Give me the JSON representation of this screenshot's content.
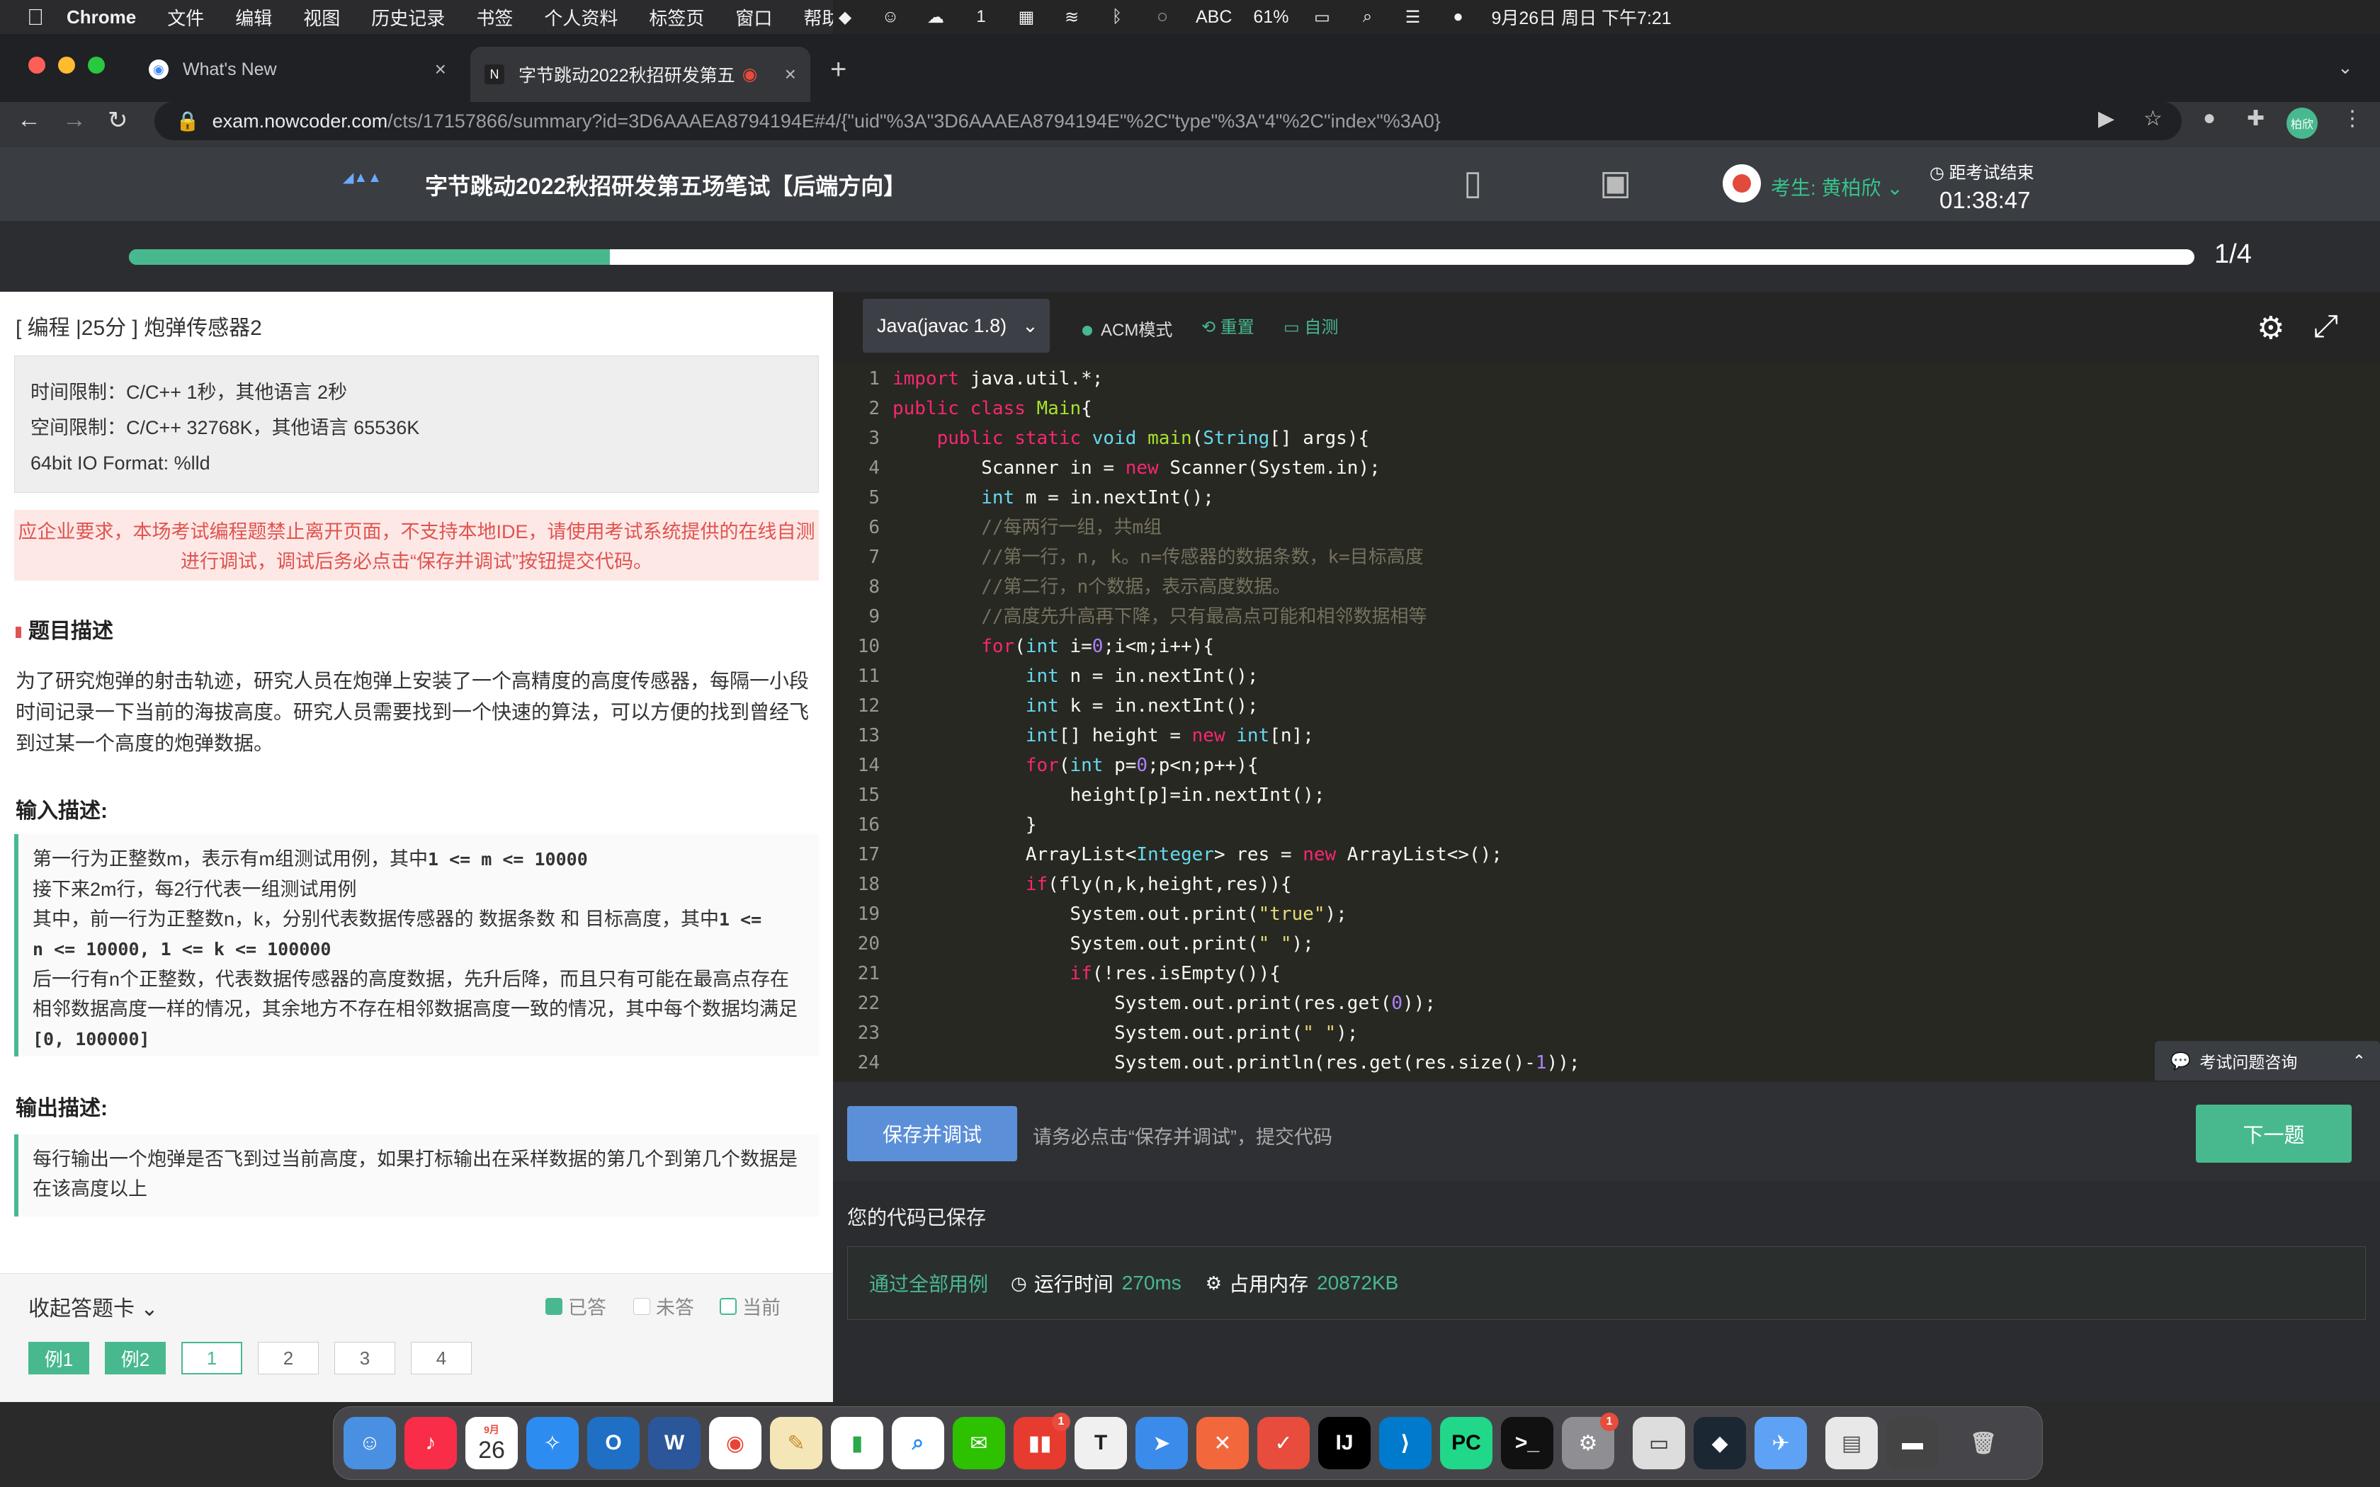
{
  "menubar": {
    "app": "Chrome",
    "items": [
      "文件",
      "编辑",
      "视图",
      "历史记录",
      "书签",
      "个人资料",
      "标签页",
      "窗口",
      "帮助"
    ],
    "status": {
      "input": "ABC",
      "battery": "61%",
      "datetime": "9月26日 周日 下午7:21",
      "wechat_count": "1"
    }
  },
  "browser": {
    "tabs": [
      {
        "title": "What's New",
        "active": false
      },
      {
        "title": "字节跳动2022秋招研发第五",
        "active": true
      }
    ],
    "url_host": "exam.nowcoder.com",
    "url_path": "/cts/17157866/summary?id=3D6AAAEA8794194E#4/{\"uid\"%3A\"3D6AAAEA8794194E\"%2C\"type\"%3A\"4\"%2C\"index\"%3A0}",
    "profile": "柏欣"
  },
  "exam": {
    "title": "字节跳动2022秋招研发第五场笔试【后端方向】",
    "candidate": "考生: 黄柏欣",
    "countdown_label": "距考试结束",
    "countdown": "01:38:47",
    "progress_fraction": 0.233,
    "progress_text": "1/4"
  },
  "question": {
    "title": "[ 编程 |25分 ] 炮弹传感器2",
    "limits": [
      "时间限制：C/C++ 1秒，其他语言 2秒",
      "空间限制：C/C++ 32768K，其他语言 65536K",
      "64bit IO Format: %lld"
    ],
    "notice": "应企业要求，本场考试编程题禁止离开页面，不支持本地IDE，请使用考试系统提供的在线自测进行调试，调试后务必点击“保存并调试”按钮提交代码。",
    "desc_heading": "题目描述",
    "desc": "为了研究炮弹的射击轨迹，研究人员在炮弹上安装了一个高精度的高度传感器，每隔一小段时间记录一下当前的海拔高度。研究人员需要找到一个快速的算法，可以方便的找到曾经飞到过某一个高度的炮弹数据。",
    "input_heading": "输入描述:",
    "input_lines": [
      "第一行为正整数m，表示有m组测试用例，其中",
      "1 <= m <= 10000",
      "接下来2m行，每2行代表一组测试用例",
      "其中，前一行为正整数n，k，分别代表数据传感器的 数据条数 和 目标高度，其中",
      "1 <=",
      "n <= 10000, 1 <= k <= 100000",
      "后一行有n个正整数，代表数据传感器的高度数据，先升后降，而且只有可能在最高点存在相邻数据高度一样的情况，其余地方不存在相邻数据高度一致的情况，其中每个数据均满足",
      "[0, 100000]"
    ],
    "output_heading": "输出描述:",
    "output": "每行输出一个炮弹是否飞到过当前高度，如果打标输出在采样数据的第几个到第几个数据是在该高度以上"
  },
  "answer_card": {
    "toggle": "收起答题卡",
    "legend": [
      "已答",
      "未答",
      "当前"
    ],
    "buttons": [
      "例1",
      "例2",
      "1",
      "2",
      "3",
      "4"
    ]
  },
  "editor": {
    "language": "Java(javac 1.8)",
    "mode": "ACM模式",
    "reset": "重置",
    "selftest": "自测",
    "consult": "考试问题咨询",
    "line_numbers": [
      "1",
      "2",
      "3",
      "4",
      "5",
      "6",
      "7",
      "8",
      "9",
      "10",
      "11",
      "12",
      "13",
      "14",
      "15",
      "16",
      "17",
      "18",
      "19",
      "20",
      "21",
      "22",
      "23",
      "24"
    ]
  },
  "actions": {
    "save": "保存并调试",
    "save_hint": "请务必点击“保存并调试”，提交代码",
    "next": "下一题"
  },
  "result": {
    "saved": "您的代码已保存",
    "pass": "通过全部用例",
    "runtime_label": "运行时间",
    "runtime": "270ms",
    "memory_label": "占用内存",
    "memory": "20872KB"
  },
  "dock": {
    "calendar_month": "9月",
    "calendar_day": "26",
    "badges": [
      "1",
      "1"
    ]
  },
  "colors": {
    "accent": "#48b98f",
    "save": "#5b8fd8",
    "notice": "#e0534f"
  }
}
